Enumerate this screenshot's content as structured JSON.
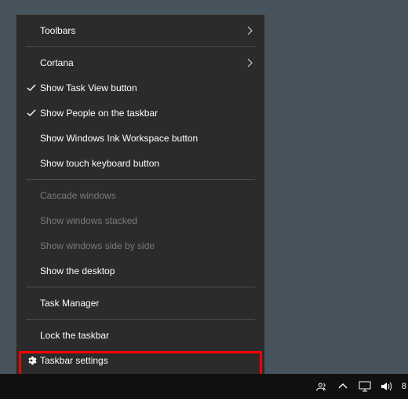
{
  "menu": {
    "toolbars": "Toolbars",
    "cortana": "Cortana",
    "show_task_view": "Show Task View button",
    "show_people": "Show People on the taskbar",
    "show_ink": "Show Windows Ink Workspace button",
    "show_touch_kb": "Show touch keyboard button",
    "cascade": "Cascade windows",
    "stacked": "Show windows stacked",
    "side_by_side": "Show windows side by side",
    "show_desktop": "Show the desktop",
    "task_manager": "Task Manager",
    "lock_taskbar": "Lock the taskbar",
    "taskbar_settings": "Taskbar settings"
  },
  "tray": {
    "time_partial": "8"
  }
}
